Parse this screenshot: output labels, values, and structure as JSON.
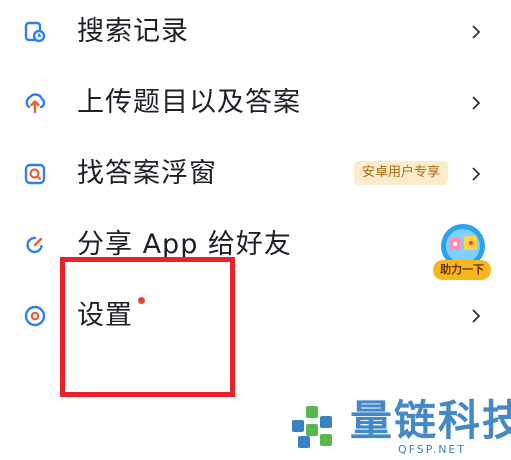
{
  "menu": {
    "items": [
      {
        "label": "搜索记录",
        "icon": "search-history-icon"
      },
      {
        "label": "上传题目以及答案",
        "icon": "upload-icon"
      },
      {
        "label": "找答案浮窗",
        "icon": "floating-window-icon",
        "tag": "安卓用户专享"
      },
      {
        "label": "分享 App 给好友",
        "icon": "share-icon",
        "badge": "助力一下"
      },
      {
        "label": "设置",
        "icon": "settings-icon"
      }
    ]
  },
  "watermark": {
    "name": "量链科技",
    "domain": "QFSP.NET"
  },
  "colors": {
    "accent": "#2f7ff0",
    "tag_bg": "#fbeccb",
    "tag_text": "#a76a12",
    "highlight": "#e8222a"
  }
}
